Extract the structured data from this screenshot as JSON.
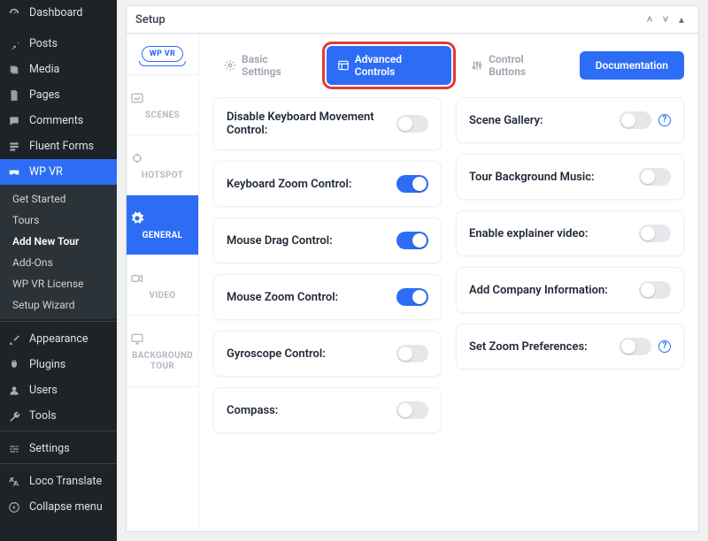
{
  "sidebar": {
    "main_items": [
      {
        "label": "Dashboard",
        "icon": "gauge"
      },
      {
        "label": "Posts",
        "icon": "pin"
      },
      {
        "label": "Media",
        "icon": "media"
      },
      {
        "label": "Pages",
        "icon": "page"
      },
      {
        "label": "Comments",
        "icon": "comment"
      },
      {
        "label": "Fluent Forms",
        "icon": "form"
      },
      {
        "label": "WP VR",
        "icon": "vr",
        "active": true
      }
    ],
    "sub_items": [
      {
        "label": "Get Started"
      },
      {
        "label": "Tours"
      },
      {
        "label": "Add New Tour",
        "current": true
      },
      {
        "label": "Add-Ons"
      },
      {
        "label": "WP VR License"
      },
      {
        "label": "Setup Wizard"
      }
    ],
    "bottom_items": [
      {
        "label": "Appearance",
        "icon": "brush"
      },
      {
        "label": "Plugins",
        "icon": "plug"
      },
      {
        "label": "Users",
        "icon": "user"
      },
      {
        "label": "Tools",
        "icon": "wrench"
      },
      {
        "label": "Settings",
        "icon": "options"
      },
      {
        "label": "Loco Translate",
        "icon": "translate"
      },
      {
        "label": "Collapse menu",
        "icon": "collapse"
      }
    ]
  },
  "setup_title": "Setup",
  "vtabs": [
    {
      "id": "logo",
      "label": "WP VR"
    },
    {
      "id": "scenes",
      "label": "SCENES"
    },
    {
      "id": "hotspot",
      "label": "HOTSPOT"
    },
    {
      "id": "general",
      "label": "GENERAL"
    },
    {
      "id": "video",
      "label": "VIDEO"
    },
    {
      "id": "bgtour",
      "label": "BACKGROUND TOUR"
    }
  ],
  "active_vtab": "general",
  "tabs": [
    {
      "label": "Basic Settings"
    },
    {
      "label": "Advanced Controls",
      "active": true
    },
    {
      "label": "Control Buttons"
    }
  ],
  "doc_button": "Documentation",
  "settings_left": [
    {
      "label": "Disable Keyboard Movement Control:",
      "on": false
    },
    {
      "label": "Keyboard Zoom Control:",
      "on": true
    },
    {
      "label": "Mouse Drag Control:",
      "on": true
    },
    {
      "label": "Mouse Zoom Control:",
      "on": true
    },
    {
      "label": "Gyroscope Control:",
      "on": false
    },
    {
      "label": "Compass:",
      "on": false
    }
  ],
  "settings_right": [
    {
      "label": "Scene Gallery:",
      "on": false,
      "info": true
    },
    {
      "label": "Tour Background Music:",
      "on": false
    },
    {
      "label": "Enable explainer video:",
      "on": false
    },
    {
      "label": "Add Company Information:",
      "on": false
    },
    {
      "label": "Set Zoom Preferences:",
      "on": false,
      "info": true
    }
  ]
}
